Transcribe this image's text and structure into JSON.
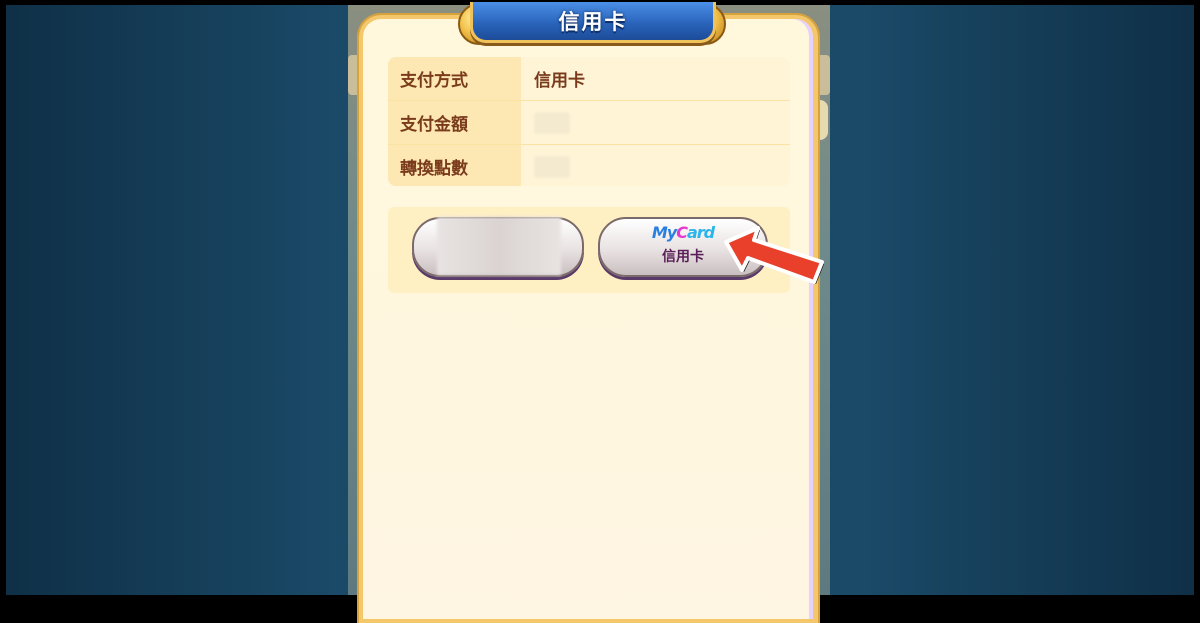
{
  "dialog": {
    "title": "信用卡"
  },
  "info": {
    "rows": [
      {
        "label": "支付方式",
        "value": "信用卡"
      },
      {
        "label": "支付金額",
        "value": ""
      },
      {
        "label": "轉換點數",
        "value": ""
      }
    ]
  },
  "buttons": {
    "left_label": "",
    "right_brand": {
      "m": "My",
      "y": "C",
      "c": "ard"
    },
    "right_label": "信用卡"
  },
  "colors": {
    "accent_arrow": "#e8402a",
    "title_banner": "#2862b8"
  }
}
